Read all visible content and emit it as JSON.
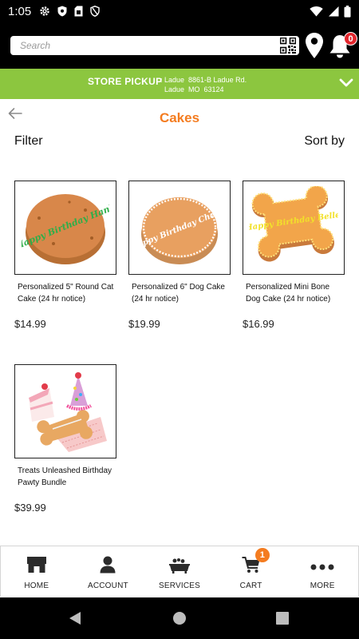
{
  "status_bar": {
    "time": "1:05",
    "left_icons": [
      "gear-icon",
      "shield-icon",
      "sim-card-icon",
      "vpn-shield-icon"
    ],
    "right_icons": [
      "wifi-icon",
      "signal-icon",
      "battery-icon"
    ]
  },
  "header": {
    "search_placeholder": "Search",
    "icons": [
      "qr-code-icon",
      "location-pin-icon",
      "bell-icon"
    ],
    "notification_count": "0"
  },
  "pickup": {
    "label": "STORE PICKUP",
    "address_line1": ": Ladue  8861-B Ladue Rd.",
    "address_line2": "  Ladue  MO  63124"
  },
  "page": {
    "title": "Cakes",
    "filter_label": "Filter",
    "sort_label": "Sort by"
  },
  "products": [
    {
      "name": "Personalized 5\" Round Cat Cake (24 hr notice)",
      "price": "$14.99",
      "image_text": "Happy Birthday Hank"
    },
    {
      "name": "Personalized 6\" Dog Cake (24 hr notice)",
      "price": "$19.99",
      "image_text": "Happy Birthday Chewie"
    },
    {
      "name": "Personalized Mini Bone Dog Cake (24 hr notice)",
      "price": "$16.99",
      "image_text": "Happy Birthday Belle"
    },
    {
      "name": "Treats Unleashed Birthday Pawty Bundle",
      "price": "$39.99"
    }
  ],
  "bottom_nav": {
    "items": [
      {
        "label": "HOME",
        "icon": "storefront-icon"
      },
      {
        "label": "ACCOUNT",
        "icon": "person-icon"
      },
      {
        "label": "SERVICES",
        "icon": "bathtub-icon"
      },
      {
        "label": "CART",
        "icon": "cart-icon"
      },
      {
        "label": "MORE",
        "icon": "more-dots-icon"
      }
    ],
    "cart_count": "1"
  },
  "colors": {
    "accent_orange": "#f47c20",
    "pickup_green": "#8cc63f",
    "badge_red": "#e3262d",
    "header_black": "#000000"
  }
}
